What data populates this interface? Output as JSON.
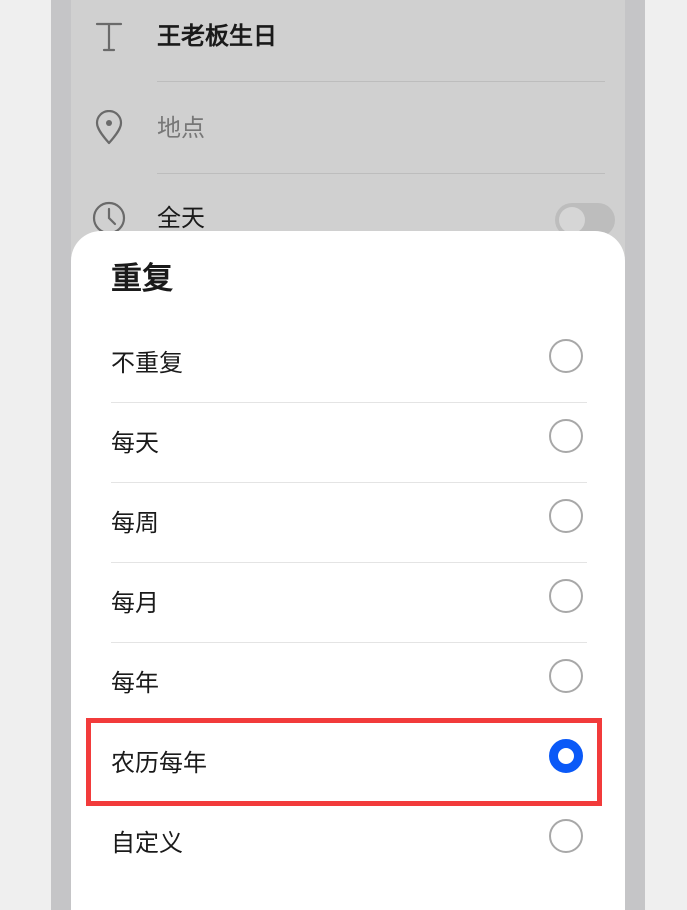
{
  "event_form": {
    "title_value": "王老板生日",
    "location_placeholder": "地点",
    "all_day_label": "全天",
    "all_day_on": false
  },
  "repeat_sheet": {
    "title": "重复",
    "options": [
      {
        "label": "不重复",
        "selected": false
      },
      {
        "label": "每天",
        "selected": false
      },
      {
        "label": "每周",
        "selected": false
      },
      {
        "label": "每月",
        "selected": false
      },
      {
        "label": "每年",
        "selected": false
      },
      {
        "label": "农历每年",
        "selected": true
      },
      {
        "label": "自定义",
        "selected": false
      }
    ]
  },
  "colors": {
    "accent": "#0a59f7",
    "highlight": "#f23b3b"
  }
}
